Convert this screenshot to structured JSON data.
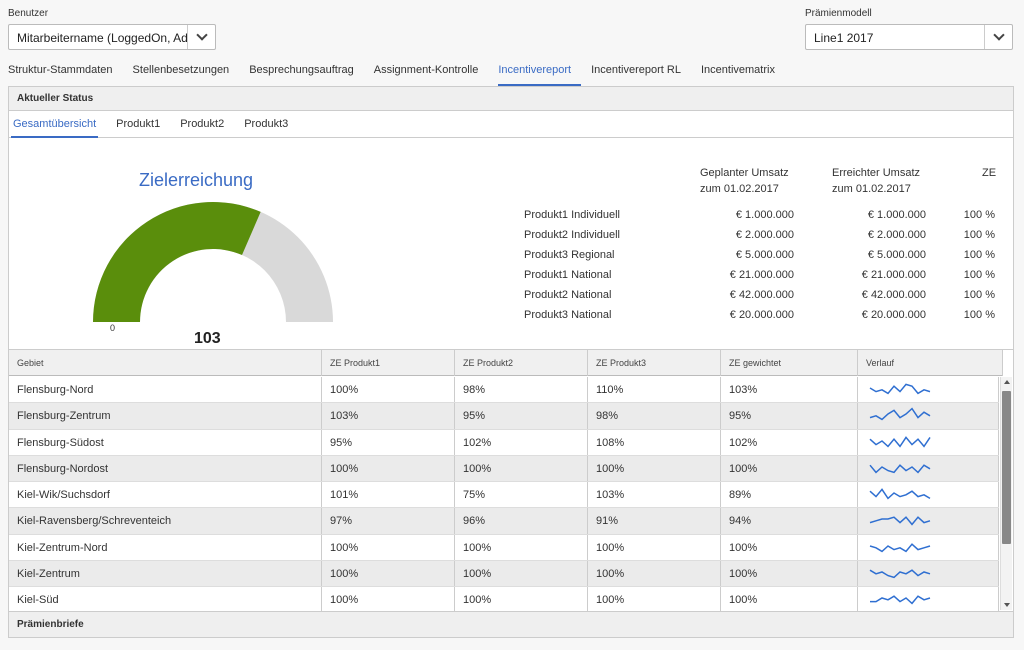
{
  "benutzer": {
    "label": "Benutzer",
    "value": "Mitarbeitername (LoggedOn, Adm"
  },
  "praemienmodell": {
    "label": "Prämienmodell",
    "value": "Line1 2017"
  },
  "main_tabs": [
    {
      "label": "Struktur-Stammdaten",
      "active": false
    },
    {
      "label": "Stellenbesetzungen",
      "active": false
    },
    {
      "label": "Besprechungsauftrag",
      "active": false
    },
    {
      "label": "Assignment-Kontrolle",
      "active": false
    },
    {
      "label": "Incentivereport",
      "active": true
    },
    {
      "label": "Incentivereport RL",
      "active": false
    },
    {
      "label": "Incentivematrix",
      "active": false
    }
  ],
  "panel_title": "Aktueller Status",
  "sub_tabs": [
    {
      "label": "Gesamtübersicht",
      "active": true
    },
    {
      "label": "Produkt1",
      "active": false
    },
    {
      "label": "Produkt2",
      "active": false
    },
    {
      "label": "Produkt3",
      "active": false
    }
  ],
  "gauge": {
    "title": "Zielerreichung",
    "min_label": "0",
    "value": "103",
    "fill_fraction": 0.63,
    "fill_color": "#5a8e0c",
    "track_color": "#d9d9d9"
  },
  "summary": {
    "headers": {
      "planned_1": "Geplanter Umsatz",
      "planned_2": "zum 01.02.2017",
      "reached_1": "Erreichter Umsatz",
      "reached_2": "zum 01.02.2017",
      "ze": "ZE"
    },
    "rows": [
      {
        "name": "Produkt1 Individuell",
        "planned": "€ 1.000.000",
        "reached": "€ 1.000.000",
        "ze": "100 %"
      },
      {
        "name": "Produkt2 Individuell",
        "planned": "€ 2.000.000",
        "reached": "€ 2.000.000",
        "ze": "100 %"
      },
      {
        "name": "Produkt3 Regional",
        "planned": "€ 5.000.000",
        "reached": "€ 5.000.000",
        "ze": "100 %"
      },
      {
        "name": "Produkt1 National",
        "planned": "€ 21.000.000",
        "reached": "€ 21.000.000",
        "ze": "100 %"
      },
      {
        "name": "Produkt2 National",
        "planned": "€ 42.000.000",
        "reached": "€ 42.000.000",
        "ze": "100 %"
      },
      {
        "name": "Produkt3 National",
        "planned": "€ 20.000.000",
        "reached": "€ 20.000.000",
        "ze": "100 %"
      }
    ]
  },
  "grid": {
    "columns": [
      "Gebiet",
      "ZE Produkt1",
      "ZE Produkt2",
      "ZE Produkt3",
      "ZE gewichtet",
      "Verlauf"
    ],
    "rows": [
      {
        "gebiet": "Flensburg-Nord",
        "p1": "100%",
        "p2": "98%",
        "p3": "110%",
        "gew": "103%",
        "trend": [
          5,
          3,
          4,
          2,
          6,
          3,
          7,
          6,
          2,
          4,
          3
        ]
      },
      {
        "gebiet": "Flensburg-Zentrum",
        "p1": "103%",
        "p2": "95%",
        "p3": "98%",
        "gew": "95%",
        "trend": [
          3,
          4,
          2,
          5,
          7,
          3,
          5,
          8,
          3,
          6,
          4
        ]
      },
      {
        "gebiet": "Flensburg-Südost",
        "p1": "95%",
        "p2": "102%",
        "p3": "108%",
        "gew": "102%",
        "trend": [
          6,
          3,
          5,
          2,
          6,
          2,
          7,
          3,
          6,
          2,
          7
        ]
      },
      {
        "gebiet": "Flensburg-Nordost",
        "p1": "100%",
        "p2": "100%",
        "p3": "100%",
        "gew": "100%",
        "trend": [
          6,
          2,
          5,
          3,
          2,
          6,
          3,
          5,
          2,
          6,
          4
        ]
      },
      {
        "gebiet": "Kiel-Wik/Suchsdorf",
        "p1": "101%",
        "p2": "75%",
        "p3": "103%",
        "gew": "89%",
        "trend": [
          6,
          3,
          7,
          2,
          5,
          3,
          4,
          6,
          3,
          4,
          2
        ]
      },
      {
        "gebiet": "Kiel-Ravensberg/Schreventeich",
        "p1": "97%",
        "p2": "96%",
        "p3": "91%",
        "gew": "94%",
        "trend": [
          3,
          4,
          5,
          5,
          6,
          3,
          6,
          2,
          6,
          3,
          4
        ]
      },
      {
        "gebiet": "Kiel-Zentrum-Nord",
        "p1": "100%",
        "p2": "100%",
        "p3": "100%",
        "gew": "100%",
        "trend": [
          5,
          4,
          2,
          5,
          3,
          4,
          2,
          6,
          3,
          4,
          5
        ]
      },
      {
        "gebiet": "Kiel-Zentrum",
        "p1": "100%",
        "p2": "100%",
        "p3": "100%",
        "gew": "100%",
        "trend": [
          6,
          4,
          5,
          3,
          2,
          5,
          4,
          6,
          3,
          5,
          4
        ]
      },
      {
        "gebiet": "Kiel-Süd",
        "p1": "100%",
        "p2": "100%",
        "p3": "100%",
        "gew": "100%",
        "trend": [
          3,
          3,
          5,
          4,
          6,
          3,
          5,
          2,
          6,
          4,
          5
        ]
      }
    ]
  },
  "footer_title": "Prämienbriefe",
  "colors": {
    "accent": "#3a6bc4",
    "spark": "#2f6fd1"
  }
}
